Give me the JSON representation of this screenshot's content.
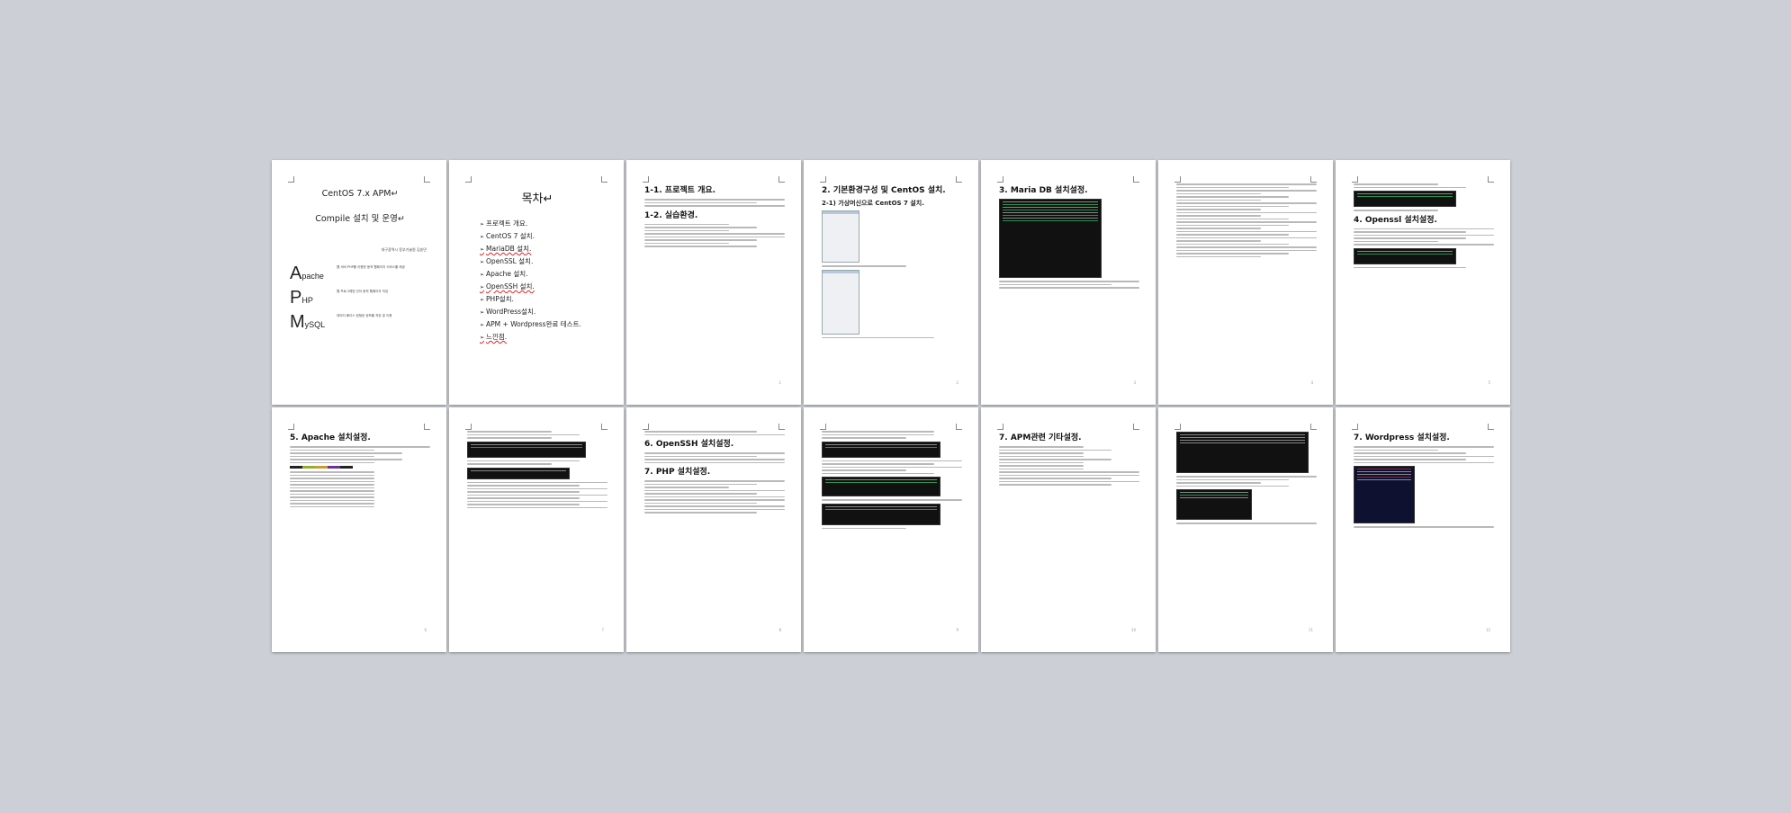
{
  "pages": {
    "p1": {
      "title_line1": "CentOS 7.x APM↵",
      "title_line2": "Compile 설치 및 운영↵",
      "author": "대구광역시 동부기술원 김송민",
      "stack": [
        {
          "letter": "A",
          "rest": "pache",
          "desc": "웹 서버 \nPHP를 이용한 동적 웹페이지 서비스를 제공"
        },
        {
          "letter": "P",
          "rest": "HP",
          "desc": "웹 프로그래밍 언어 \n동적 웹페이지 작성"
        },
        {
          "letter": "M",
          "rest": "ySQL",
          "desc": "데이터 베이스 \n정형된 정보를 저장 및 이용"
        }
      ]
    },
    "p2": {
      "title": "목차↵",
      "items": [
        "프로젝트 개요.",
        "CentOS 7 설치.",
        "MariaDB 설치.",
        "OpenSSL 설치.",
        "Apache 설치.",
        "OpenSSH 설치.",
        "PHP설치.",
        "WordPress설치.",
        "APM + Wordpress완료 테스트.",
        "느낀점."
      ]
    },
    "p3": {
      "h1": "1-1. 프로젝트 개요.",
      "h2": "1-2. 실습환경."
    },
    "p4": {
      "h1": "2. 기본환경구성 및 CentOS 설치.",
      "h2": "2-1) 가상머신으로 CentOS 7 설치."
    },
    "p5": {
      "h1": "3. Maria DB 설치설정."
    },
    "p7": {
      "h1": "4. Openssl 설치설정."
    },
    "p8": {
      "h1": "5. Apache 설치설정."
    },
    "p10": {
      "h1": "6. OpenSSH 설치설정.",
      "h1b": "7. PHP 설치설정."
    },
    "p12": {
      "h1": "7. APM관련 기타설정."
    },
    "p14": {
      "h1": "7. Wordpress 설치설정."
    }
  }
}
